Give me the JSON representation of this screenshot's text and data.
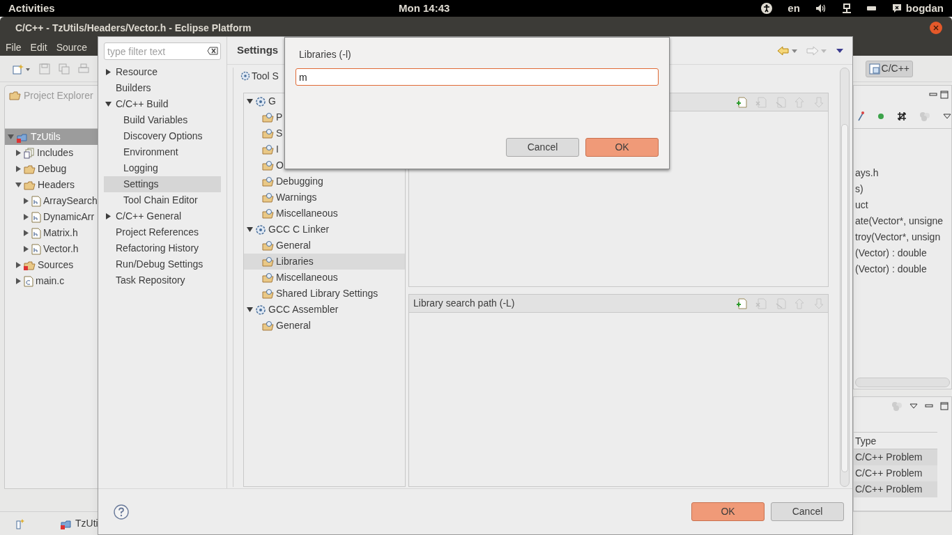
{
  "top_bar": {
    "activities": "Activities",
    "clock": "Mon 14:43",
    "language": "en",
    "user": "bogdan"
  },
  "window": {
    "title": "C/C++ - TzUtils/Headers/Vector.h - Eclipse Platform"
  },
  "menu": [
    "File",
    "Edit",
    "Source"
  ],
  "project_explorer": {
    "title": "Project Explorer",
    "tree": [
      {
        "label": "TzUtils",
        "kind": "project",
        "expanded": true,
        "selected": true,
        "children": [
          {
            "label": "Includes",
            "kind": "includes",
            "expanded": false,
            "selected": false
          },
          {
            "label": "Debug",
            "kind": "folder",
            "expanded": false,
            "selected": false
          },
          {
            "label": "Headers",
            "kind": "folder",
            "expanded": true,
            "selected": false,
            "children": [
              {
                "label": "ArraySearch",
                "kind": "header",
                "expanded": false,
                "selected": false
              },
              {
                "label": "DynamicArr",
                "kind": "header",
                "expanded": false,
                "selected": false
              },
              {
                "label": "Matrix.h",
                "kind": "header",
                "expanded": false,
                "selected": false
              },
              {
                "label": "Vector.h",
                "kind": "header",
                "expanded": false,
                "selected": false
              }
            ]
          },
          {
            "label": "Sources",
            "kind": "source_folder",
            "expanded": false,
            "selected": false
          },
          {
            "label": "main.c",
            "kind": "c_file",
            "expanded": false,
            "selected": false
          }
        ]
      }
    ]
  },
  "perspective": {
    "label": "C/C++",
    "selected": true
  },
  "outline": {
    "lines": [
      "ays.h",
      "s)",
      "uct",
      "ate(Vector*, unsigne",
      "troy(Vector*, unsign",
      "(Vector) : double",
      "(Vector) : double"
    ]
  },
  "problems": {
    "columns": [
      "Type"
    ],
    "rows": [
      "C/C++ Problem",
      "C/C++ Problem",
      "C/C++ Problem"
    ]
  },
  "taskbar": {
    "project": "TzUti"
  },
  "properties": {
    "filter_placeholder": "type filter text",
    "nav": [
      {
        "label": "Resource",
        "expanded": false,
        "selected": false
      },
      {
        "label": "Builders",
        "selected": false
      },
      {
        "label": "C/C++ Build",
        "expanded": true,
        "selected": false,
        "children": [
          {
            "label": "Build Variables",
            "selected": false
          },
          {
            "label": "Discovery Options",
            "selected": false
          },
          {
            "label": "Environment",
            "selected": false
          },
          {
            "label": "Logging",
            "selected": false
          },
          {
            "label": "Settings",
            "selected": true
          },
          {
            "label": "Tool Chain Editor",
            "selected": false
          }
        ]
      },
      {
        "label": "C/C++ General",
        "expanded": false,
        "selected": false
      },
      {
        "label": "Project References",
        "selected": false
      },
      {
        "label": "Refactoring History",
        "selected": false
      },
      {
        "label": "Run/Debug Settings",
        "selected": false
      },
      {
        "label": "Task Repository",
        "selected": false
      }
    ],
    "page_title": "Settings",
    "tab": "Tool S",
    "tool_tree": [
      {
        "label": "G",
        "kind": "tool",
        "expanded": true,
        "selected": false,
        "children": [
          {
            "label": "P",
            "kind": "option",
            "selected": false
          },
          {
            "label": "S",
            "kind": "option",
            "selected": false
          },
          {
            "label": "I",
            "kind": "option",
            "selected": false
          },
          {
            "label": "O",
            "kind": "option",
            "selected": false
          },
          {
            "label": "Debugging",
            "kind": "option",
            "selected": false
          },
          {
            "label": "Warnings",
            "kind": "option",
            "selected": false
          },
          {
            "label": "Miscellaneous",
            "kind": "option",
            "selected": false
          }
        ]
      },
      {
        "label": "GCC C Linker",
        "kind": "tool",
        "expanded": true,
        "selected": false,
        "children": [
          {
            "label": "General",
            "kind": "option",
            "selected": false
          },
          {
            "label": "Libraries",
            "kind": "option",
            "selected": true
          },
          {
            "label": "Miscellaneous",
            "kind": "option",
            "selected": false
          },
          {
            "label": "Shared Library Settings",
            "kind": "option",
            "selected": false
          }
        ]
      },
      {
        "label": "GCC Assembler",
        "kind": "tool",
        "expanded": true,
        "selected": false,
        "children": [
          {
            "label": "General",
            "kind": "option",
            "selected": false
          }
        ]
      }
    ],
    "library_search_path": {
      "title": "Library search path (-L)"
    },
    "buttons": [
      {
        "label": "OK",
        "default": true
      },
      {
        "label": "Cancel",
        "default": false
      }
    ]
  },
  "input_dialog": {
    "label": "Libraries (-l)",
    "value": "m",
    "buttons": [
      {
        "label": "Cancel",
        "default": false
      },
      {
        "label": "OK",
        "default": true
      }
    ]
  }
}
